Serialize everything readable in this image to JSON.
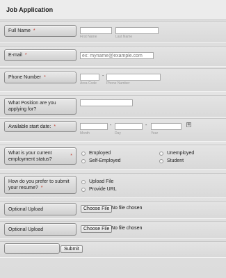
{
  "form": {
    "title": "Job Application"
  },
  "fullname": {
    "label": "Full Name",
    "required": "*",
    "first_sub": "First Name",
    "last_sub": "Last Name"
  },
  "email": {
    "label": "E-mail",
    "required": "*",
    "placeholder": "ex: myname@example.com"
  },
  "phone": {
    "label": "Phone Number",
    "required": "*",
    "dash": "-",
    "area_sub": "Area Code",
    "number_sub": "Phone Number"
  },
  "position": {
    "label": "What Position are you applying for?"
  },
  "startdate": {
    "label": "Available start date:",
    "required": "*",
    "dash": "-",
    "month_sub": "Month",
    "day_sub": "Day",
    "year_sub": "Year"
  },
  "employment": {
    "label": "What is your current employment status?",
    "required": "*",
    "options": [
      "Employed",
      "Unemployed",
      "Self-Employed",
      "Student"
    ]
  },
  "submit_method": {
    "label": "How do you prefer to submit your resume?",
    "required": "*",
    "options": [
      "Upload File",
      "Provide URL"
    ]
  },
  "upload1": {
    "label": "Optional Upload",
    "button": "Choose File",
    "status": "No file chosen"
  },
  "upload2": {
    "label": "Optional Upload",
    "button": "Choose File",
    "status": "No file chosen"
  },
  "submit": {
    "label": "Submit"
  }
}
